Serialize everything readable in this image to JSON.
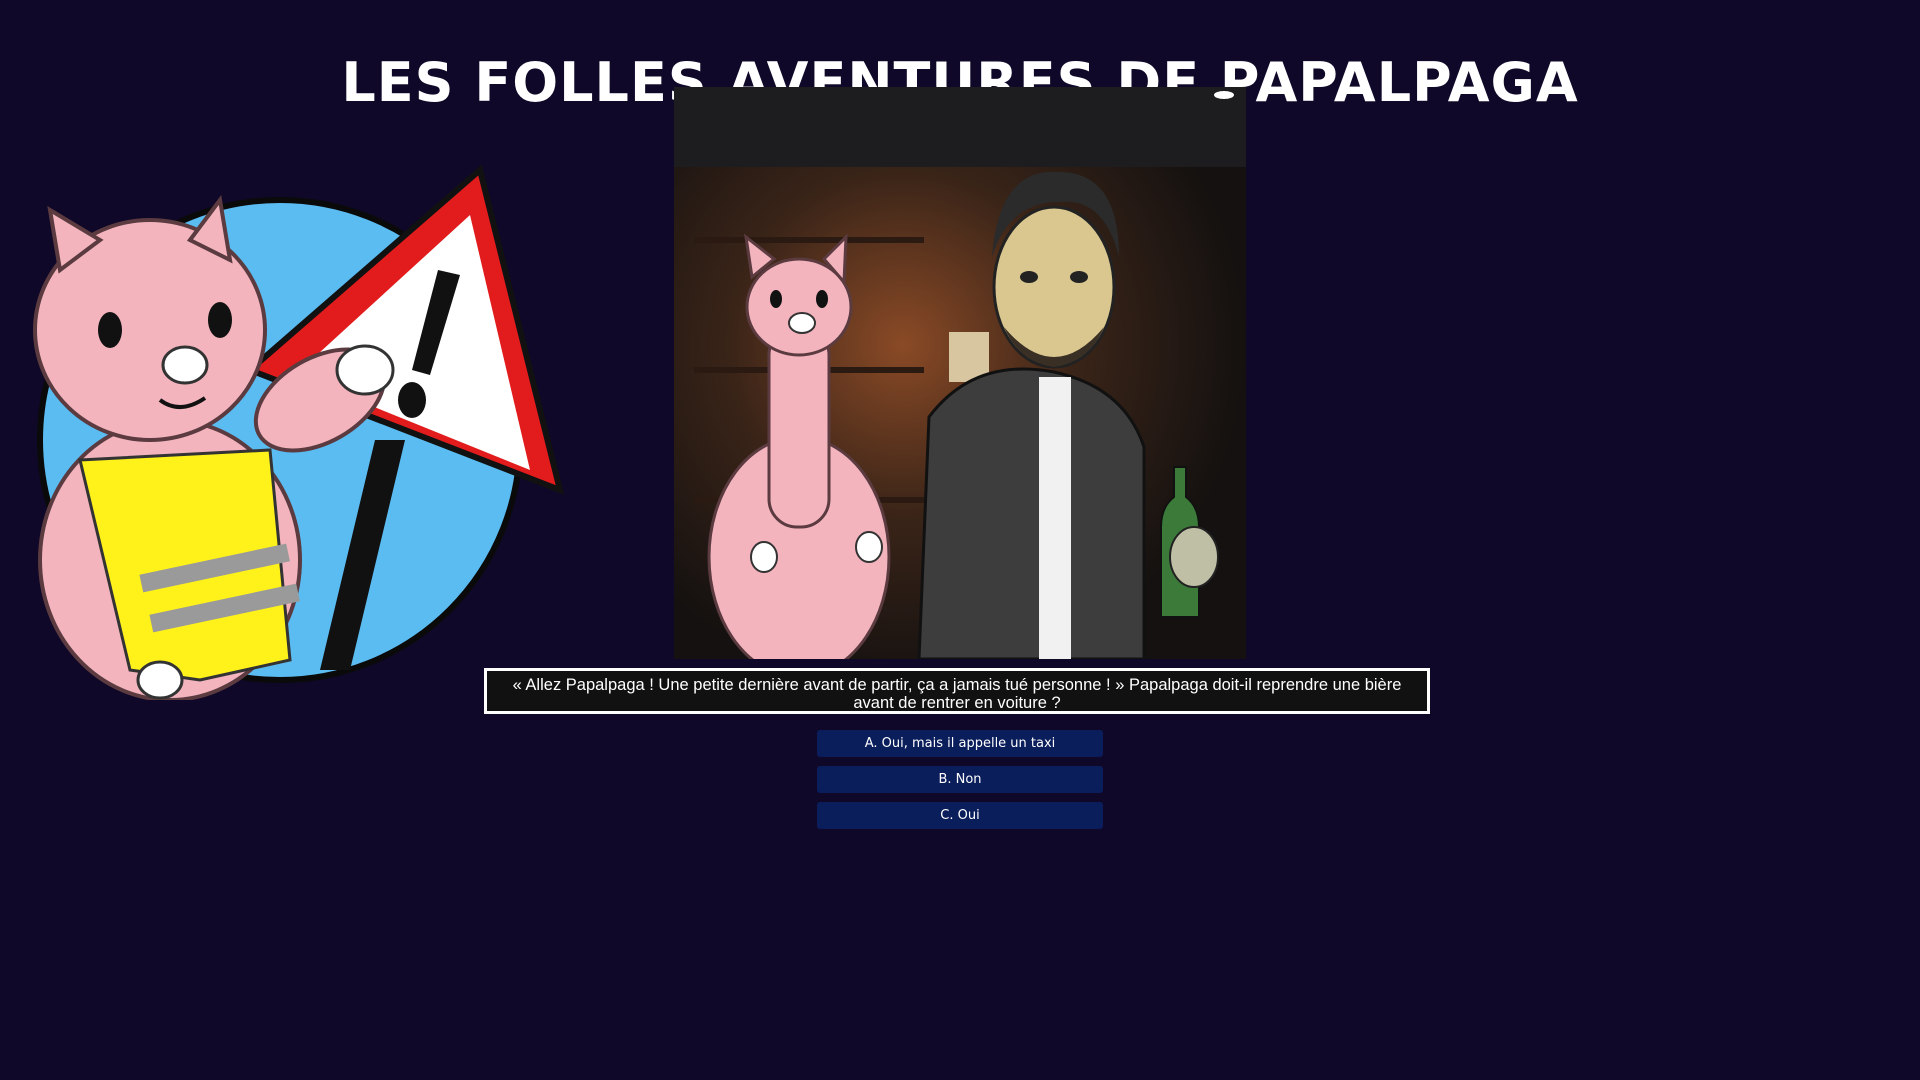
{
  "header": {
    "title": "Les folles aventures de Papalpaga"
  },
  "images": {
    "mascot": "alpaca-warning-sign-mascot",
    "scene": "alpaca-and-man-in-bar-scene"
  },
  "question": {
    "text": "« Allez Papalpaga ! Une petite dernière avant de partir, ça a jamais tué personne ! » Papalpaga doit-il reprendre une bière avant de rentrer en voiture ?"
  },
  "answers": [
    {
      "label": "A. Oui, mais il appelle un taxi"
    },
    {
      "label": "B. Non"
    },
    {
      "label": "C. Oui"
    }
  ],
  "colors": {
    "background": "#100828",
    "button": "#0b1e5c",
    "question_box": "#111111",
    "question_border": "#ffffff"
  }
}
